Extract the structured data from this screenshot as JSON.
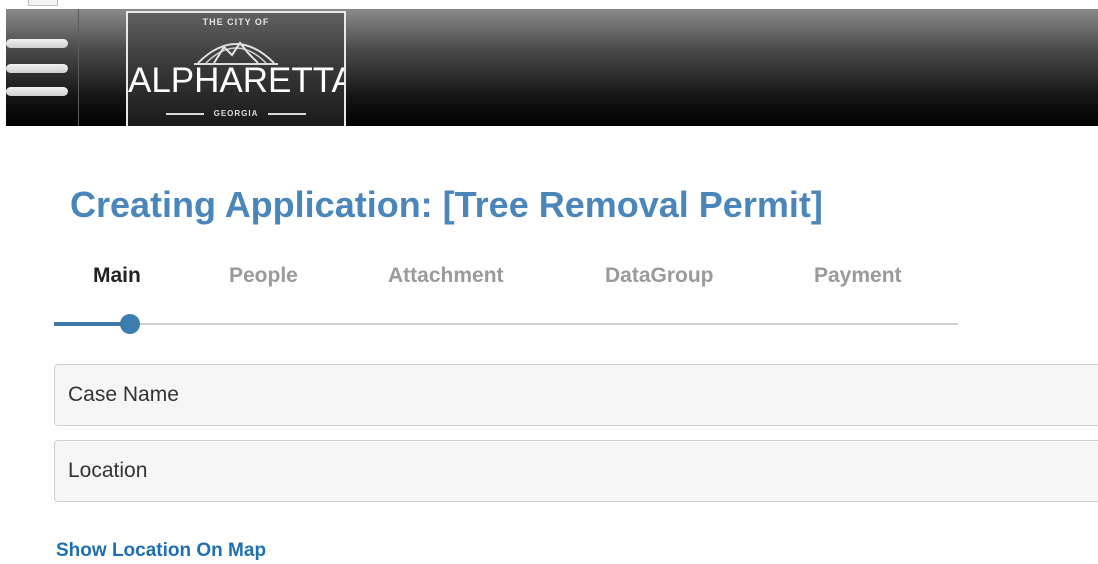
{
  "header": {
    "menu_icon": "hamburger-menu-icon",
    "logo": {
      "top_text": "THE CITY OF",
      "name": "ALPHARETTA",
      "sub_text": "GEORGIA"
    }
  },
  "page": {
    "title": "Creating Application: [Tree Removal Permit]"
  },
  "tabs": [
    {
      "label": "Main",
      "active": true
    },
    {
      "label": "People",
      "active": false
    },
    {
      "label": "Attachment",
      "active": false
    },
    {
      "label": "DataGroup",
      "active": false
    },
    {
      "label": "Payment",
      "active": false
    }
  ],
  "progress": {
    "current_step": 1,
    "total_steps": 5
  },
  "form": {
    "case_name_placeholder": "Case Name",
    "location_placeholder": "Location",
    "show_map_link": "Show Location On Map"
  },
  "colors": {
    "title": "#4a86b9",
    "progress": "#3d7dae",
    "link": "#1f6fb2"
  }
}
